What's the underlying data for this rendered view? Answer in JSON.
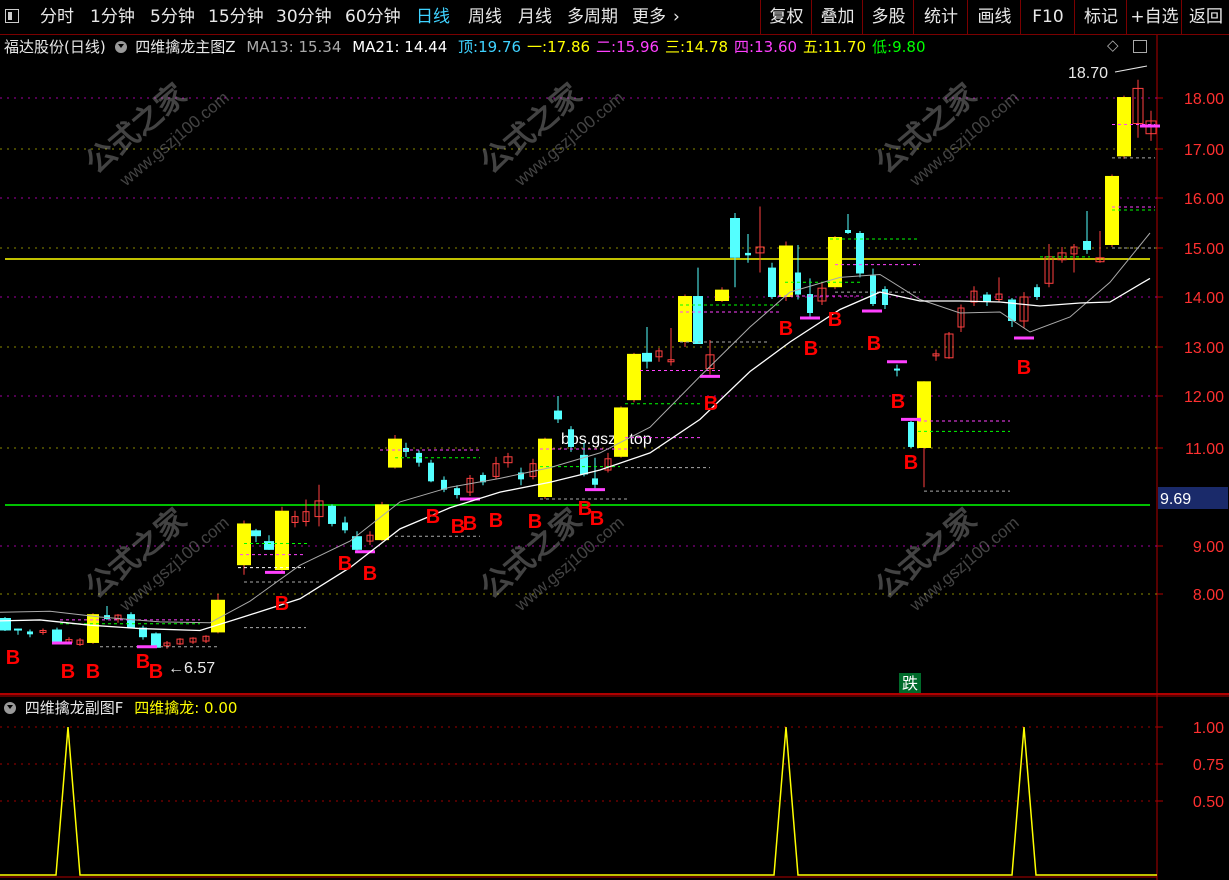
{
  "toolbar": {
    "periods": [
      "分时",
      "1分钟",
      "5分钟",
      "15分钟",
      "30分钟",
      "60分钟",
      "日线",
      "周线",
      "月线",
      "多周期",
      "更多"
    ],
    "active_period": "日线",
    "actions": [
      "复权",
      "叠加",
      "多股",
      "统计",
      "画线",
      "F10",
      "标记",
      "+自选",
      "返回"
    ]
  },
  "main_info": {
    "stock": "福达股份(日线)",
    "indicator": "四维擒龙主图Z",
    "ma13": "MA13: 15.34",
    "ma21": "MA21: 14.44",
    "levels": [
      {
        "label": "顶:",
        "value": "19.76",
        "color": "#3fd2ff"
      },
      {
        "label": "一:",
        "value": "17.86",
        "color": "#ffff00"
      },
      {
        "label": "二:",
        "value": "15.96",
        "color": "#ff40ff"
      },
      {
        "label": "三:",
        "value": "14.78",
        "color": "#ffff00"
      },
      {
        "label": "四:",
        "value": "13.60",
        "color": "#ff40ff"
      },
      {
        "label": "五:",
        "value": "11.70",
        "color": "#ffff00"
      },
      {
        "label": "低:",
        "value": "9.80",
        "color": "#00ff00"
      }
    ]
  },
  "price_axis": {
    "ticks": [
      "18.00",
      "17.00",
      "16.00",
      "15.00",
      "14.00",
      "13.00",
      "12.00",
      "11.00",
      "9.00",
      "8.00"
    ],
    "current": "9.69"
  },
  "annotations": {
    "high_label": "18.70",
    "low_label": "6.57",
    "buy_mark": "B",
    "fall_badge": "跌",
    "watermark_text": "bbs.gszb.top",
    "watermark_cn": "公式之家",
    "watermark_url": "www.gszj100.com"
  },
  "sub_info": {
    "indicator": "四维擒龙副图F",
    "value_label": "四维擒龙: 0.00"
  },
  "sub_axis": {
    "ticks": [
      "1.00",
      "0.75",
      "0.50"
    ]
  },
  "colors": {
    "up": "#ffff00",
    "down": "#54ffff",
    "frame": "#b00000",
    "ma_white": "#ffffff",
    "ma_gray": "#aaaaaa",
    "yellow_line": "#ffff00",
    "green_line": "#00ff00",
    "buy": "#ff0000"
  }
}
